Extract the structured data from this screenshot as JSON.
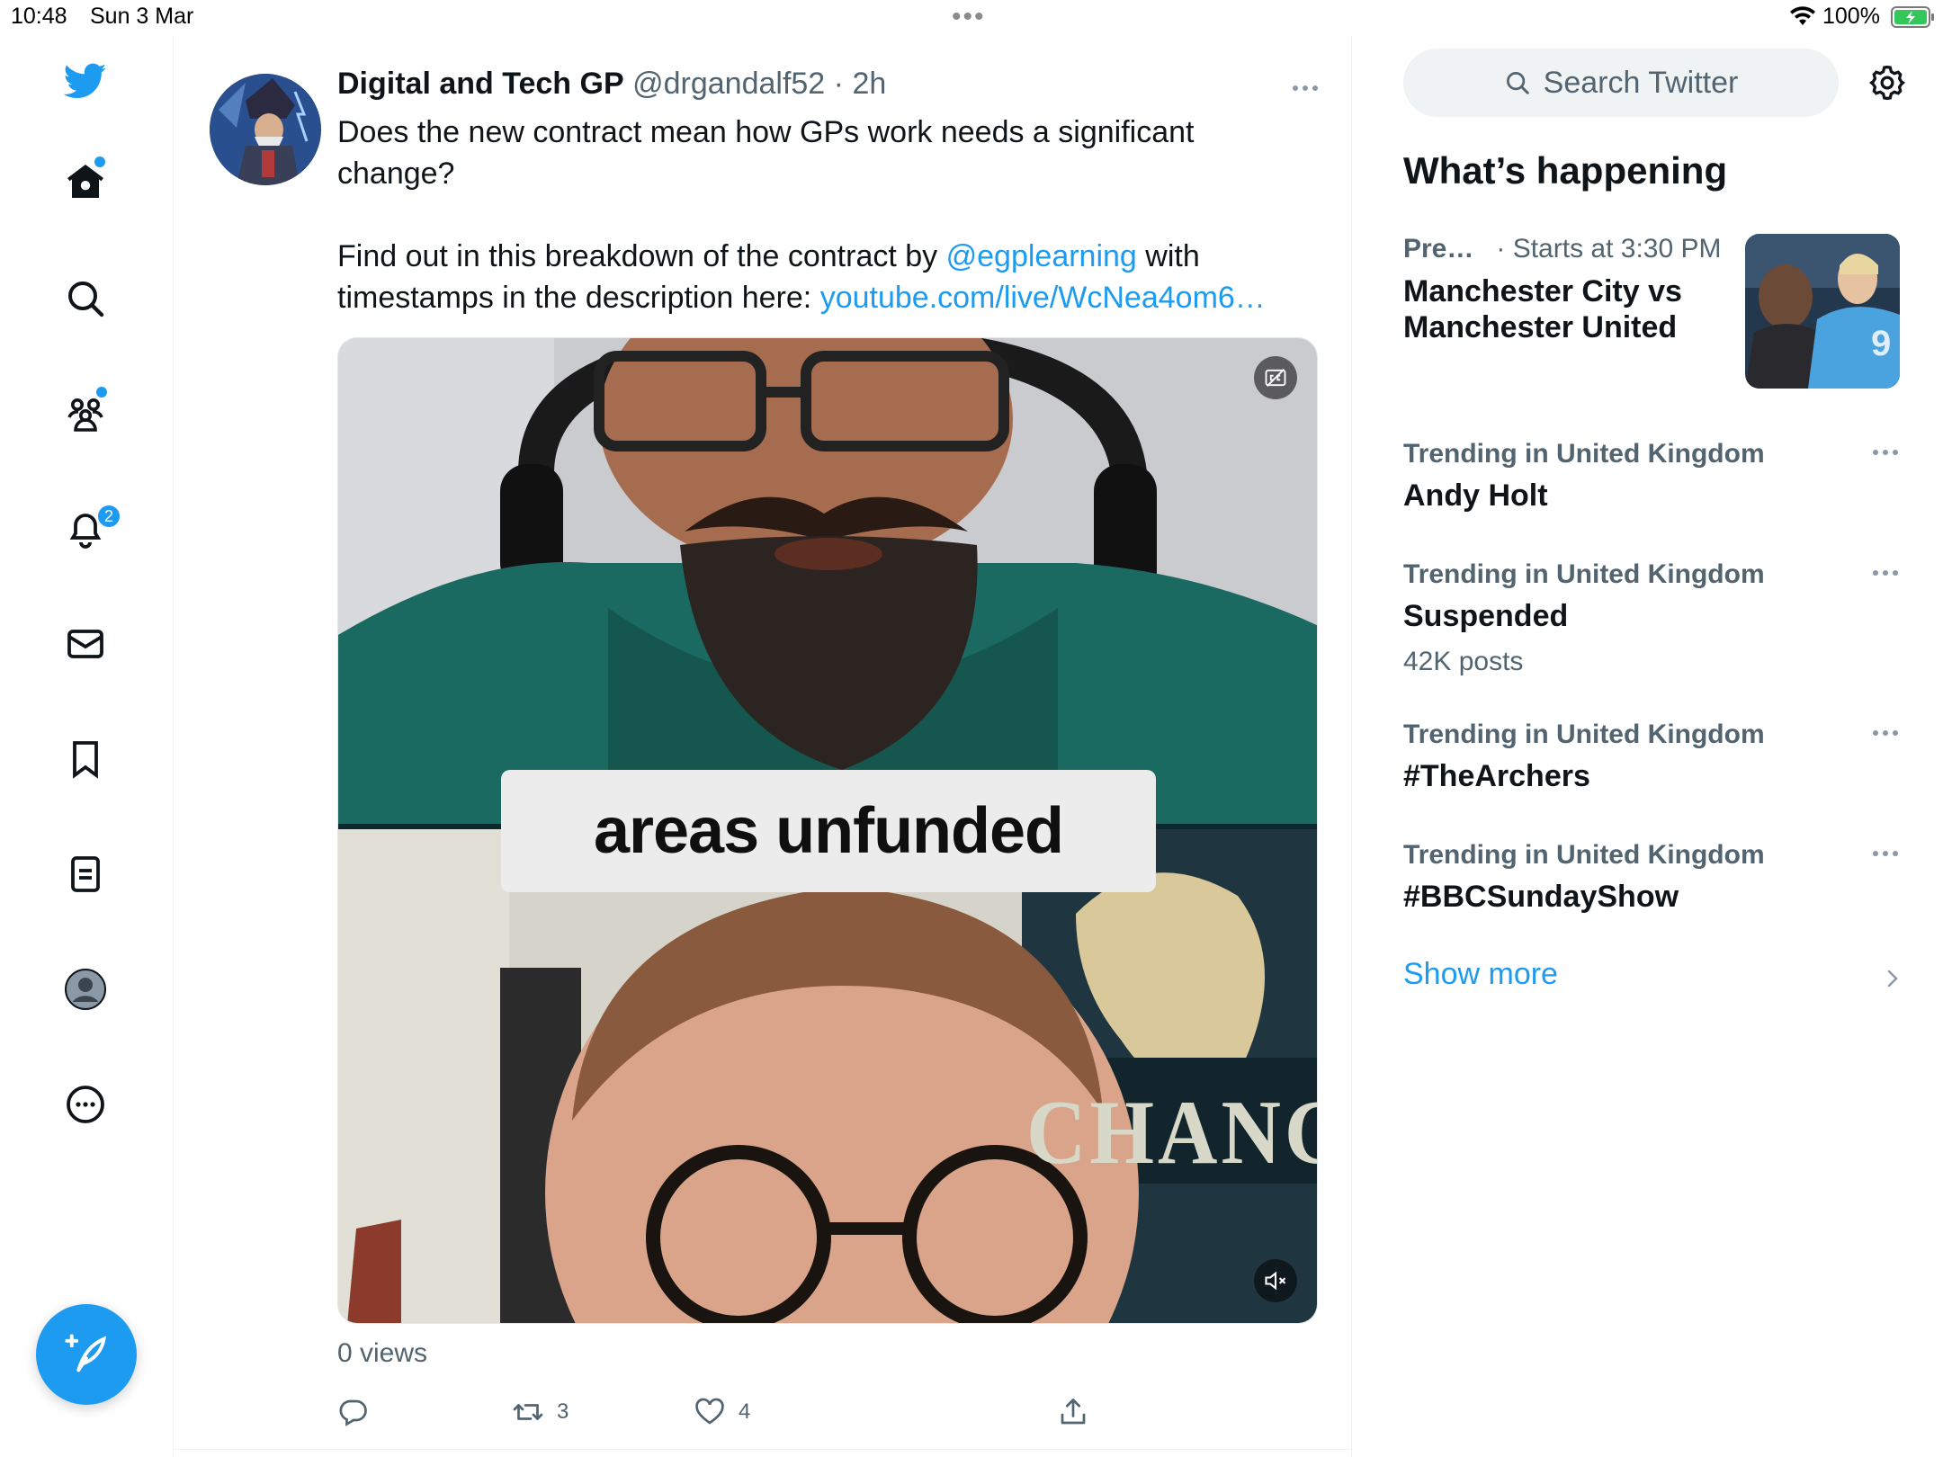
{
  "status_bar": {
    "time": "10:48",
    "date": "Sun 3 Mar",
    "battery": "100%"
  },
  "nav": {
    "items": [
      {
        "name": "home",
        "icon": "home-icon",
        "has_dot": true
      },
      {
        "name": "explore",
        "icon": "search-icon"
      },
      {
        "name": "communities",
        "icon": "communities-icon",
        "has_dot": true
      },
      {
        "name": "notifications",
        "icon": "bell-icon",
        "badge": "2"
      },
      {
        "name": "messages",
        "icon": "envelope-icon"
      },
      {
        "name": "bookmarks",
        "icon": "bookmark-icon"
      },
      {
        "name": "lists",
        "icon": "list-icon"
      },
      {
        "name": "profile",
        "icon": "profile-avatar-icon"
      },
      {
        "name": "more",
        "icon": "more-circle-icon"
      }
    ],
    "notifications_badge": "2",
    "compose_icon": "compose-feather-icon"
  },
  "tweet": {
    "author_name": "Digital and Tech GP",
    "author_handle": "@drgandalf52",
    "separator": "·",
    "time": "2h",
    "text_line1": "Does the new contract mean how GPs work needs a significant change?",
    "text_line2_pre": "Find out in this breakdown of the contract by ",
    "mention": "@egplearning",
    "text_line2_mid": " with timestamps in the description here: ",
    "link": "youtube.com/live/WcNea4om6…",
    "media_caption": "areas unfunded",
    "media_poster_text": "CHANG",
    "views": "0 views",
    "actions": {
      "reply_count": "",
      "retweet_count": "3",
      "like_count": "4"
    }
  },
  "sidebar": {
    "search_placeholder": "Search Twitter",
    "heading": "What’s happening",
    "event": {
      "category": "Pre…",
      "meta": "· Starts at 3:30 PM",
      "title": "Manchester City vs Manchester United"
    },
    "trends": [
      {
        "context": "Trending in United Kingdom",
        "name": "Andy Holt",
        "posts": ""
      },
      {
        "context": "Trending in United Kingdom",
        "name": "Suspended",
        "posts": "42K posts"
      },
      {
        "context": "Trending in United Kingdom",
        "name": "#TheArchers",
        "posts": ""
      },
      {
        "context": "Trending in United Kingdom",
        "name": "#BBCSundayShow",
        "posts": ""
      }
    ],
    "show_more": "Show more"
  },
  "colors": {
    "accent": "#1d9bf0",
    "text": "#0f1419",
    "secondary": "#536471",
    "search_bg": "#eff3f4"
  }
}
